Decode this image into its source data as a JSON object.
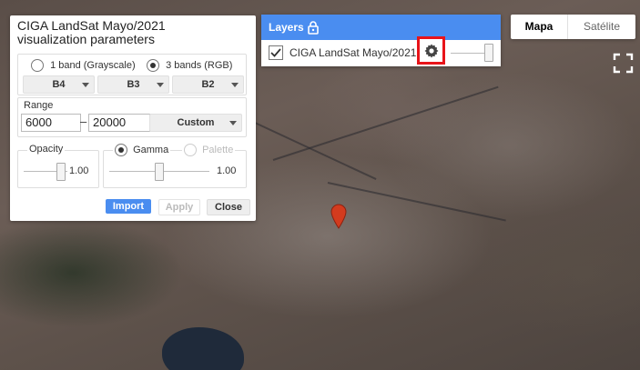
{
  "viz_panel": {
    "title_line1": "CIGA LandSat Mayo/2021",
    "title_line2": "visualization parameters",
    "band_mode_1": "1 band (Grayscale)",
    "band_mode_3": "3 bands (RGB)",
    "band_mode_selected": "3 bands (RGB)",
    "bands": [
      "B4",
      "B3",
      "B2"
    ],
    "range_label": "Range",
    "range_min": "6000",
    "range_sep": "–",
    "range_max": "20000",
    "range_preset": "Custom",
    "opacity_label": "Opacity",
    "opacity_value": "1.00",
    "gamma_label": "Gamma",
    "palette_label": "Palette",
    "gamma_value": "1.00",
    "import_label": "Import",
    "apply_label": "Apply",
    "close_label": "Close"
  },
  "layers": {
    "header": "Layers",
    "items": [
      {
        "name": "CIGA LandSat Mayo/2021",
        "checked": true
      }
    ]
  },
  "map_type": {
    "map_label": "Mapa",
    "satellite_label": "Satélite",
    "selected": "Mapa"
  },
  "colors": {
    "accent": "#4a8df0",
    "import_button": "#4a8df0",
    "highlight": "#e8141a",
    "marker": "#d33b1e"
  },
  "icons": {
    "settings": "gear-icon",
    "lock": "lock-icon",
    "fullscreen": "fullscreen-icon",
    "marker": "map-pin-icon"
  }
}
